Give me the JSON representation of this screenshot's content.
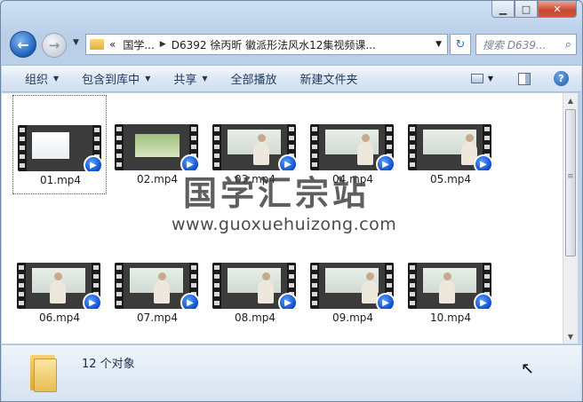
{
  "window": {
    "caption_min": "▁",
    "caption_max": "□",
    "caption_close": "✕"
  },
  "nav": {
    "back_glyph": "←",
    "forward_glyph": "→",
    "history_glyph": "▼"
  },
  "address": {
    "overflow": "«",
    "crumbs": [
      "国学...",
      "D6392 徐丙昕 徽派形法风水12集视频课..."
    ],
    "separator": "▶",
    "dropdown_glyph": "▼"
  },
  "refresh_glyph": "↻",
  "search": {
    "placeholder": "搜索 D639...",
    "icon_glyph": "⌕"
  },
  "toolbar": {
    "organize": "组织",
    "include_in_library": "包含到库中",
    "share": "共享",
    "play_all": "全部播放",
    "new_folder": "新建文件夹",
    "dropdown_glyph": "▼",
    "help_glyph": "?"
  },
  "files": [
    {
      "name": "01.mp4",
      "selected": true
    },
    {
      "name": "02.mp4",
      "selected": false
    },
    {
      "name": "03.mp4",
      "selected": false
    },
    {
      "name": "04.mp4",
      "selected": false
    },
    {
      "name": "05.mp4",
      "selected": false
    },
    {
      "name": "06.mp4",
      "selected": false
    },
    {
      "name": "07.mp4",
      "selected": false
    },
    {
      "name": "08.mp4",
      "selected": false
    },
    {
      "name": "09.mp4",
      "selected": false
    },
    {
      "name": "10.mp4",
      "selected": false
    }
  ],
  "watermark": {
    "title": "国学汇宗站",
    "url": "www.guoxuehuizong.com"
  },
  "scrollbar": {
    "up_glyph": "▲",
    "down_glyph": "▼"
  },
  "status": {
    "item_count": "12 个对象"
  }
}
